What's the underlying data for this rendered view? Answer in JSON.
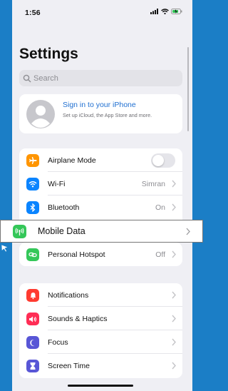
{
  "status_bar": {
    "time": "1:56"
  },
  "header": {
    "title": "Settings"
  },
  "search": {
    "placeholder": "Search"
  },
  "account": {
    "title": "Sign in to your iPhone",
    "subtitle": "Set up iCloud, the App Store and more."
  },
  "connectivity": {
    "airplane": {
      "label": "Airplane Mode",
      "toggle_on": false
    },
    "wifi": {
      "label": "Wi-Fi",
      "value": "Simran"
    },
    "bluetooth": {
      "label": "Bluetooth",
      "value": "On"
    },
    "mobile_data": {
      "label": "Mobile Data"
    },
    "hotspot": {
      "label": "Personal Hotspot",
      "value": "Off"
    }
  },
  "general": {
    "notifications": {
      "label": "Notifications"
    },
    "sounds": {
      "label": "Sounds & Haptics"
    },
    "focus": {
      "label": "Focus"
    },
    "screen_time": {
      "label": "Screen Time"
    }
  },
  "colors": {
    "background": "#1b7ec6",
    "airplane": "#ff9500",
    "wifi": "#0a84ff",
    "bluetooth": "#0a84ff",
    "mobile_data": "#34c759",
    "hotspot": "#34c759",
    "notifications": "#ff3b30",
    "sounds": "#ff2d55",
    "focus": "#5856d6",
    "screen_time": "#5856d6",
    "link": "#1f6fd1"
  },
  "icons": {
    "airplane": "airplane-icon",
    "wifi": "wifi-icon",
    "bluetooth": "bluetooth-icon",
    "mobile_data": "antenna-icon",
    "hotspot": "hotspot-link-icon",
    "notifications": "bell-icon",
    "sounds": "speaker-icon",
    "focus": "moon-icon",
    "screen_time": "hourglass-icon"
  }
}
